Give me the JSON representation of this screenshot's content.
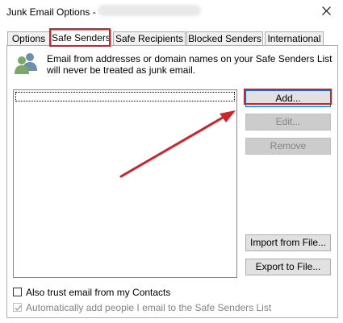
{
  "window": {
    "title": "Junk Email Options -",
    "close_icon": "close-icon"
  },
  "tabs": [
    {
      "label": "Options",
      "selected": false
    },
    {
      "label": "Safe Senders",
      "selected": true
    },
    {
      "label": "Safe Recipients",
      "selected": false
    },
    {
      "label": "Blocked Senders",
      "selected": false
    },
    {
      "label": "International",
      "selected": false
    }
  ],
  "safe_senders": {
    "icon": "people-icon",
    "description": "Email from addresses or domain names on your Safe Senders List will never be treated as junk email.",
    "list_items": [],
    "buttons": {
      "add": "Add...",
      "edit": "Edit...",
      "remove": "Remove",
      "import": "Import from File...",
      "export": "Export to File..."
    },
    "checkboxes": {
      "trust_contacts": {
        "label": "Also trust email from my Contacts",
        "checked": false,
        "enabled": true
      },
      "auto_add": {
        "label": "Automatically add people I email to the Safe Senders List",
        "checked": true,
        "enabled": false
      }
    }
  },
  "annotation": {
    "highlight_color": "#d1222b",
    "arrow_color": "#d1222b"
  }
}
